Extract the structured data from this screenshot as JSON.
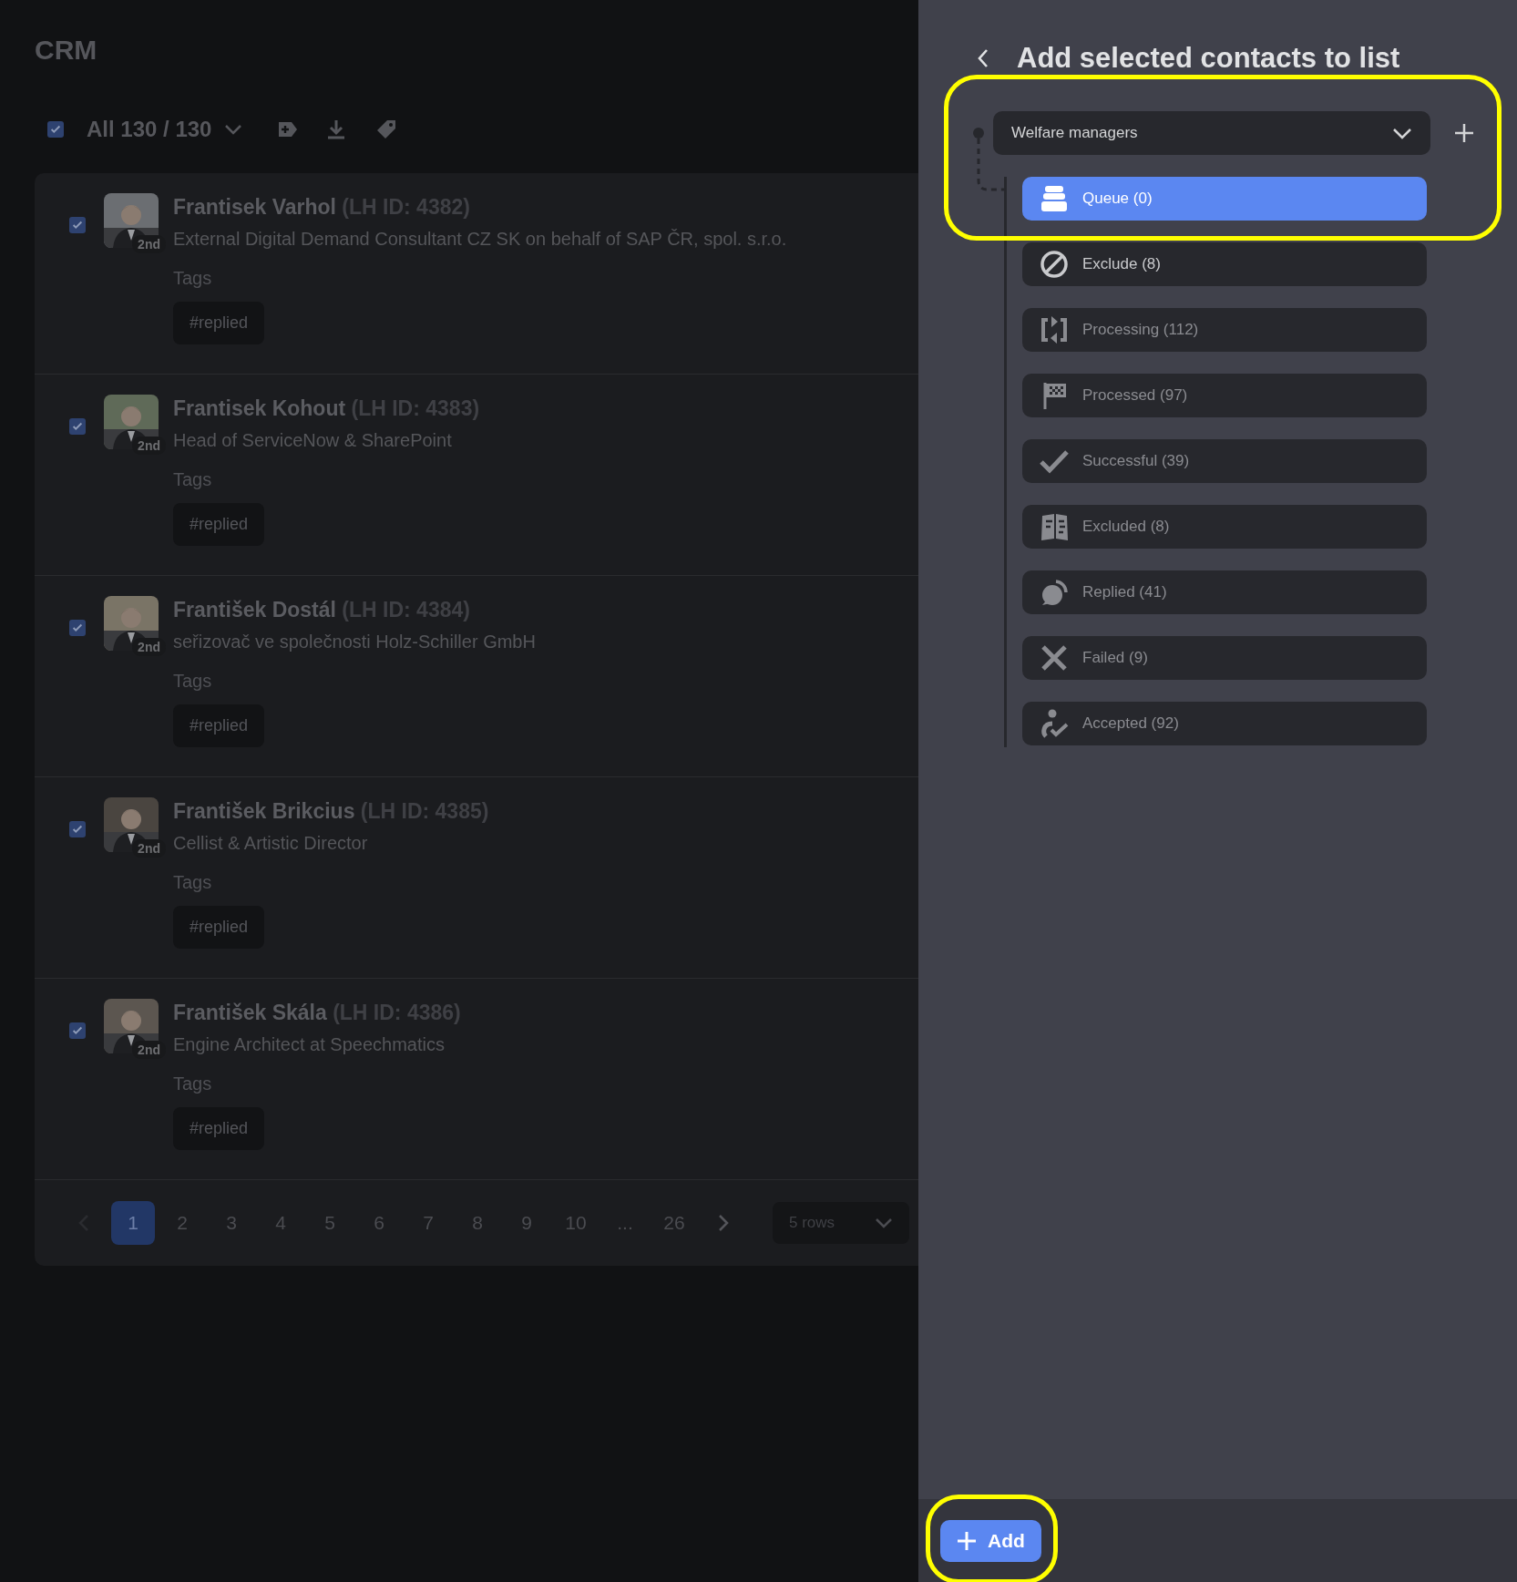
{
  "app_title": "CRM",
  "toolbar": {
    "select_all_checked": true,
    "selection": "All 130 / 130"
  },
  "contacts": [
    {
      "checked": true,
      "degree": "2nd",
      "name": "Frantisek Varhol",
      "lh_id": "(LH ID: 4382)",
      "headline": "External Digital Demand Consultant CZ SK on behalf of SAP ČR, spol. s.r.o.",
      "tags_label": "Tags",
      "tags": [
        "#replied"
      ]
    },
    {
      "checked": true,
      "degree": "2nd",
      "name": "Frantisek Kohout",
      "lh_id": "(LH ID: 4383)",
      "headline": "Head of ServiceNow & SharePoint",
      "tags_label": "Tags",
      "tags": [
        "#replied"
      ]
    },
    {
      "checked": true,
      "degree": "2nd",
      "name": "František Dostál",
      "lh_id": "(LH ID: 4384)",
      "headline": "seřizovač ve společnosti Holz-Schiller GmbH",
      "tags_label": "Tags",
      "tags": [
        "#replied"
      ]
    },
    {
      "checked": true,
      "degree": "2nd",
      "name": "František Brikcius",
      "lh_id": "(LH ID: 4385)",
      "headline": "Cellist & Artistic Director",
      "tags_label": "Tags",
      "tags": [
        "#replied"
      ]
    },
    {
      "checked": true,
      "degree": "2nd",
      "name": "František Skála",
      "lh_id": "(LH ID: 4386)",
      "headline": "Engine Architect at Speechmatics",
      "tags_label": "Tags",
      "tags": [
        "#replied"
      ]
    }
  ],
  "pagination": {
    "pages": [
      {
        "label": "1",
        "selected": true
      },
      {
        "label": "2",
        "selected": false
      },
      {
        "label": "3",
        "selected": false
      },
      {
        "label": "4",
        "selected": false
      },
      {
        "label": "5",
        "selected": false
      },
      {
        "label": "6",
        "selected": false
      },
      {
        "label": "7",
        "selected": false
      },
      {
        "label": "8",
        "selected": false
      },
      {
        "label": "9",
        "selected": false
      },
      {
        "label": "10",
        "selected": false
      },
      {
        "label": "...",
        "selected": false
      },
      {
        "label": "26",
        "selected": false
      }
    ],
    "prev_disabled": true,
    "rows": "5 rows"
  },
  "panel": {
    "title": "Add selected contacts to list",
    "list": "Welfare managers",
    "statuses": [
      {
        "kind": "queue",
        "label": "Queue (0)",
        "selected": true,
        "disabled": false
      },
      {
        "kind": "exclude",
        "label": "Exclude (8)",
        "selected": false,
        "disabled": false
      },
      {
        "kind": "processing",
        "label": "Processing (112)",
        "selected": false,
        "disabled": true
      },
      {
        "kind": "processed",
        "label": "Processed (97)",
        "selected": false,
        "disabled": true
      },
      {
        "kind": "successful",
        "label": "Successful (39)",
        "selected": false,
        "disabled": true
      },
      {
        "kind": "excluded",
        "label": "Excluded (8)",
        "selected": false,
        "disabled": true
      },
      {
        "kind": "replied",
        "label": "Replied (41)",
        "selected": false,
        "disabled": true
      },
      {
        "kind": "failed",
        "label": "Failed (9)",
        "selected": false,
        "disabled": true
      },
      {
        "kind": "accepted",
        "label": "Accepted (92)",
        "selected": false,
        "disabled": true
      }
    ],
    "add_button": "Add"
  }
}
